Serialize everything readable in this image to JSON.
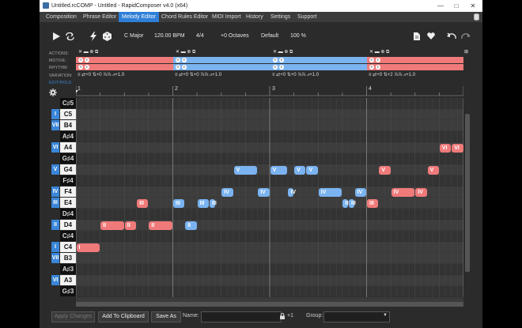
{
  "titlebar": {
    "title": "Untitled.rcCOMP - Untitled - RapidComposer v4.0 (x64)"
  },
  "menu": [
    "Composition",
    "Phrase Editor",
    "Melody Editor",
    "Chord Rules Editor",
    "MIDI Import",
    "History",
    "Settings",
    "Support"
  ],
  "menu_active": "Melody Editor",
  "toolbar": {
    "key": "C Major",
    "tempo": "120.00 BPM",
    "timesig": "4/4",
    "octaves": "+0 Octaves",
    "style": "Default",
    "zoom": "100 %"
  },
  "tracks": {
    "labels": [
      "ACTIONS:",
      "MOTIVE:",
      "RHYTHM:",
      "VARIATION:"
    ],
    "bottom_label": "EDIT/HOLD",
    "segments": [
      {
        "color": "red",
        "variation": "≡ ⇄+0  ⇅+0  ⅞⅞  ⩘+1.0"
      },
      {
        "color": "blue",
        "variation": "≡ ⇄+0  ⇅+0  ⅞⅞  ⩘+1.0"
      },
      {
        "color": "blue",
        "variation": "≡ ⇄+0  ⇅+0  ⅞⅞  ⩘+1.0"
      },
      {
        "color": "red",
        "variation": "≡ ⇄+0  ⇅+2  ⅞⅞  ⩘+1.0"
      }
    ]
  },
  "ruler": [
    "1",
    "2",
    "3",
    "4"
  ],
  "keys": [
    {
      "note": "C♯5",
      "deg": "",
      "black": true
    },
    {
      "note": "C5",
      "deg": "I",
      "black": false
    },
    {
      "note": "B4",
      "deg": "VII",
      "black": false
    },
    {
      "note": "A♯4",
      "deg": "",
      "black": true
    },
    {
      "note": "A4",
      "deg": "VI",
      "black": false
    },
    {
      "note": "G♯4",
      "deg": "",
      "black": true
    },
    {
      "note": "G4",
      "deg": "V",
      "black": false
    },
    {
      "note": "F♯4",
      "deg": "",
      "black": true
    },
    {
      "note": "F4",
      "deg": "IV",
      "black": false
    },
    {
      "note": "E4",
      "deg": "III",
      "black": false
    },
    {
      "note": "D♯4",
      "deg": "",
      "black": true
    },
    {
      "note": "D4",
      "deg": "II",
      "black": false
    },
    {
      "note": "C♯4",
      "deg": "",
      "black": true
    },
    {
      "note": "C4",
      "deg": "I",
      "black": false
    },
    {
      "note": "B3",
      "deg": "VII",
      "black": false
    },
    {
      "note": "A♯3",
      "deg": "",
      "black": true
    },
    {
      "note": "A3",
      "deg": "VI",
      "black": false
    },
    {
      "note": "G♯3",
      "deg": "",
      "black": true
    }
  ],
  "notes": [
    {
      "row": 13,
      "start": 0.0,
      "len": 0.25,
      "color": "red",
      "label": "I"
    },
    {
      "row": 11,
      "start": 0.25,
      "len": 0.25,
      "color": "red",
      "label": "II"
    },
    {
      "row": 11,
      "start": 0.5,
      "len": 0.125,
      "color": "red",
      "label": "II"
    },
    {
      "row": 9,
      "start": 0.625,
      "len": 0.125,
      "color": "red",
      "label": "III"
    },
    {
      "row": 11,
      "start": 0.75,
      "len": 0.25,
      "color": "red",
      "label": "II"
    },
    {
      "row": 9,
      "start": 1.0,
      "len": 0.125,
      "color": "blue",
      "label": "III"
    },
    {
      "row": 11,
      "start": 1.125,
      "len": 0.125,
      "color": "blue",
      "label": "II"
    },
    {
      "row": 9,
      "start": 1.25,
      "len": 0.125,
      "color": "blue",
      "label": "III"
    },
    {
      "row": 9,
      "start": 1.375,
      "len": 0.0625,
      "color": "blue",
      "label": "III"
    },
    {
      "row": 8,
      "start": 1.5,
      "len": 0.125,
      "color": "blue",
      "label": "IV"
    },
    {
      "row": 6,
      "start": 1.625,
      "len": 0.25,
      "color": "blue",
      "label": "V"
    },
    {
      "row": 8,
      "start": 1.875,
      "len": 0.125,
      "color": "blue",
      "label": "IV"
    },
    {
      "row": 6,
      "start": 2.0,
      "len": 0.1875,
      "color": "blue",
      "label": "V"
    },
    {
      "row": 8,
      "start": 2.1875,
      "len": 0.0625,
      "color": "blue",
      "label": "IV"
    },
    {
      "row": 6,
      "start": 2.25,
      "len": 0.125,
      "color": "blue",
      "label": "V"
    },
    {
      "row": 6,
      "start": 2.375,
      "len": 0.125,
      "color": "blue",
      "label": "V"
    },
    {
      "row": 8,
      "start": 2.5,
      "len": 0.25,
      "color": "blue",
      "label": "IV"
    },
    {
      "row": 9,
      "start": 2.75,
      "len": 0.0625,
      "color": "blue",
      "label": "III"
    },
    {
      "row": 9,
      "start": 2.8125,
      "len": 0.0625,
      "color": "blue",
      "label": "III"
    },
    {
      "row": 8,
      "start": 2.875,
      "len": 0.125,
      "color": "blue",
      "label": "IV"
    },
    {
      "row": 9,
      "start": 3.0,
      "len": 0.125,
      "color": "red",
      "label": "III"
    },
    {
      "row": 6,
      "start": 3.125,
      "len": 0.125,
      "color": "red",
      "label": "V"
    },
    {
      "row": 8,
      "start": 3.25,
      "len": 0.25,
      "color": "red",
      "label": "IV"
    },
    {
      "row": 8,
      "start": 3.5,
      "len": 0.125,
      "color": "red",
      "label": "IV"
    },
    {
      "row": 6,
      "start": 3.625,
      "len": 0.125,
      "color": "red",
      "label": "V"
    },
    {
      "row": 4,
      "start": 3.75,
      "len": 0.125,
      "color": "red",
      "label": "VI"
    },
    {
      "row": 4,
      "start": 3.875,
      "len": 0.125,
      "color": "red",
      "label": "VI"
    }
  ],
  "bottom": {
    "apply": "Apply Changes",
    "clipboard": "Add To Clipboard",
    "saveas": "Save As",
    "name_label": "Name:",
    "group_label": "Group:",
    "plus": "+1"
  },
  "colors": {
    "accent": "#2f7fd8",
    "note_red": "#f07a7a",
    "note_blue": "#7ab3f0",
    "degree": "#3a86d9"
  }
}
